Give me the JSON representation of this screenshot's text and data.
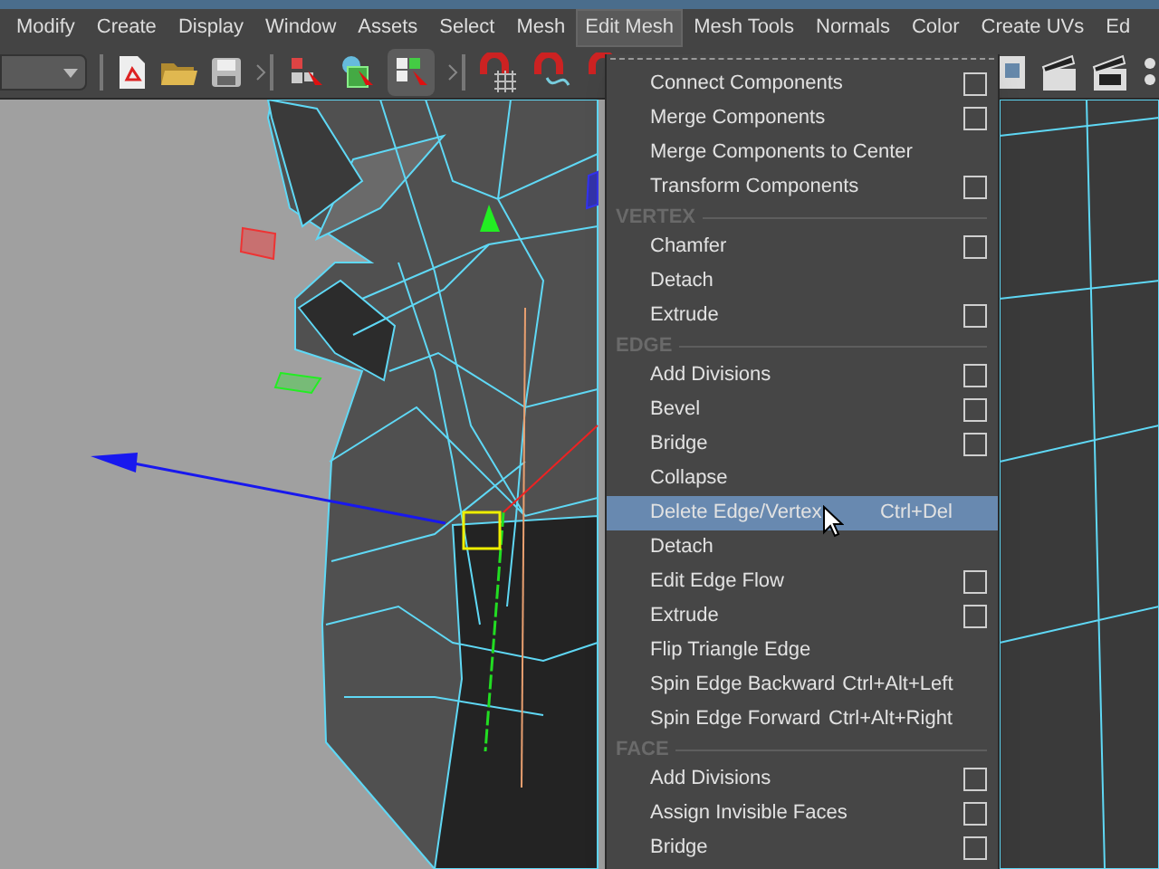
{
  "menu_bar": [
    {
      "label": "Modify",
      "selected": false
    },
    {
      "label": "Create",
      "selected": false
    },
    {
      "label": "Display",
      "selected": false
    },
    {
      "label": "Window",
      "selected": false
    },
    {
      "label": "Assets",
      "selected": false
    },
    {
      "label": "Select",
      "selected": false
    },
    {
      "label": "Mesh",
      "selected": false
    },
    {
      "label": "Edit Mesh",
      "selected": true
    },
    {
      "label": "Mesh Tools",
      "selected": false
    },
    {
      "label": "Normals",
      "selected": false
    },
    {
      "label": "Color",
      "selected": false
    },
    {
      "label": "Create UVs",
      "selected": false
    },
    {
      "label": "Ed",
      "selected": false
    }
  ],
  "menu": [
    {
      "kind": "item",
      "label": "Connect Components",
      "option_box": true,
      "selected": false
    },
    {
      "kind": "item",
      "label": "Merge Components",
      "option_box": true,
      "selected": false
    },
    {
      "kind": "item",
      "label": "Merge Components to Center",
      "option_box": false,
      "selected": false
    },
    {
      "kind": "item",
      "label": "Transform Components",
      "option_box": true,
      "selected": false
    },
    {
      "kind": "section",
      "label": "VERTEX"
    },
    {
      "kind": "item",
      "label": "Chamfer",
      "option_box": true,
      "selected": false
    },
    {
      "kind": "item",
      "label": "Detach",
      "option_box": false,
      "selected": false
    },
    {
      "kind": "item",
      "label": "Extrude",
      "option_box": true,
      "selected": false
    },
    {
      "kind": "section",
      "label": "EDGE"
    },
    {
      "kind": "item",
      "label": "Add Divisions",
      "option_box": true,
      "selected": false
    },
    {
      "kind": "item",
      "label": "Bevel",
      "option_box": true,
      "selected": false
    },
    {
      "kind": "item",
      "label": "Bridge",
      "option_box": true,
      "selected": false
    },
    {
      "kind": "item",
      "label": "Collapse",
      "option_box": false,
      "selected": false
    },
    {
      "kind": "item",
      "label": "Delete Edge/Vertex",
      "shortcut": "Ctrl+Del",
      "option_box": false,
      "selected": true
    },
    {
      "kind": "item",
      "label": "Detach",
      "option_box": false,
      "selected": false
    },
    {
      "kind": "item",
      "label": "Edit Edge Flow",
      "option_box": true,
      "selected": false
    },
    {
      "kind": "item",
      "label": "Extrude",
      "option_box": true,
      "selected": false
    },
    {
      "kind": "item",
      "label": "Flip Triangle Edge",
      "option_box": false,
      "selected": false
    },
    {
      "kind": "item",
      "label": "Spin Edge Backward",
      "shortcut": "Ctrl+Alt+Left",
      "option_box": false,
      "selected": false
    },
    {
      "kind": "item",
      "label": "Spin Edge Forward",
      "shortcut": "Ctrl+Alt+Right",
      "option_box": false,
      "selected": false
    },
    {
      "kind": "section",
      "label": "FACE"
    },
    {
      "kind": "item",
      "label": "Add Divisions",
      "option_box": true,
      "selected": false
    },
    {
      "kind": "item",
      "label": "Assign Invisible Faces",
      "option_box": true,
      "selected": false
    },
    {
      "kind": "item",
      "label": "Bridge",
      "option_box": true,
      "selected": false
    }
  ]
}
